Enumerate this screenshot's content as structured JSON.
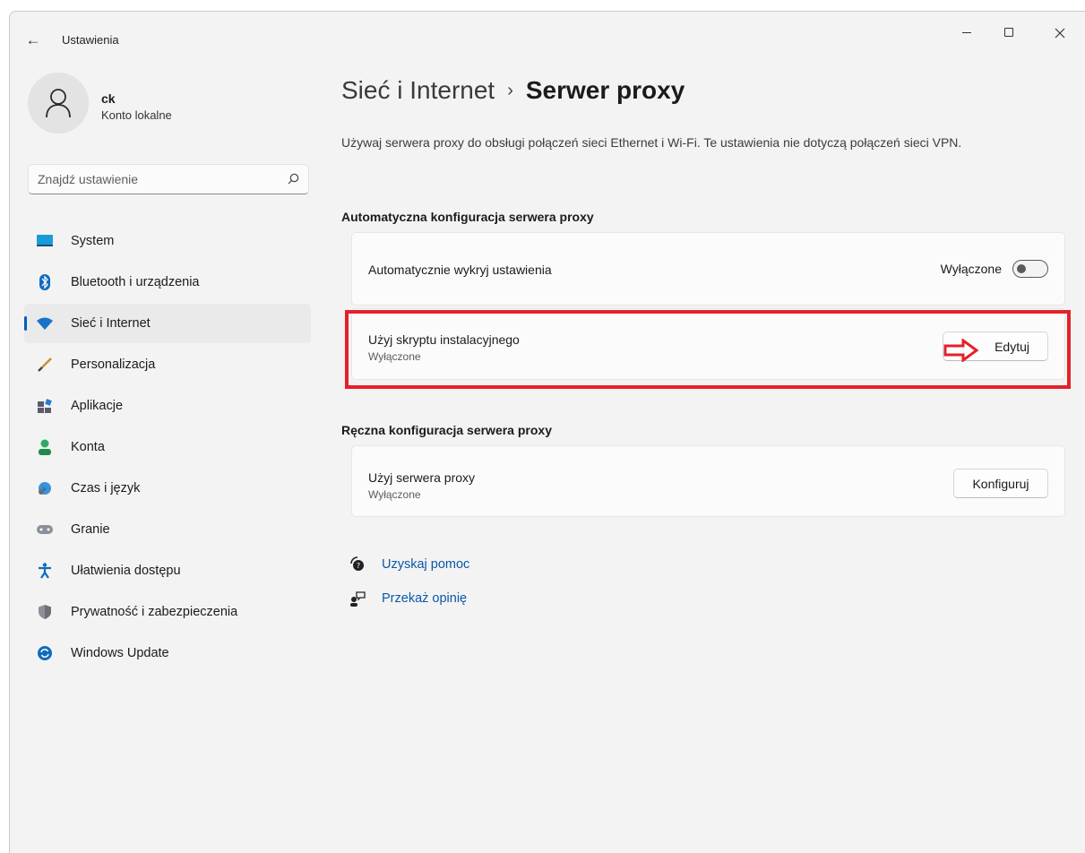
{
  "window": {
    "title": "Ustawienia",
    "back_icon": "back-arrow-icon"
  },
  "profile": {
    "name": "ck",
    "account_type": "Konto lokalne"
  },
  "search": {
    "placeholder": "Znajdź ustawienie"
  },
  "nav": {
    "items": [
      {
        "label": "System",
        "icon": "system-monitor-icon"
      },
      {
        "label": "Bluetooth i urządzenia",
        "icon": "bluetooth-icon"
      },
      {
        "label": "Sieć i Internet",
        "icon": "wifi-icon",
        "active": true
      },
      {
        "label": "Personalizacja",
        "icon": "brush-icon"
      },
      {
        "label": "Aplikacje",
        "icon": "apps-icon"
      },
      {
        "label": "Konta",
        "icon": "account-icon"
      },
      {
        "label": "Czas i język",
        "icon": "globe-clock-icon"
      },
      {
        "label": "Granie",
        "icon": "gamepad-icon"
      },
      {
        "label": "Ułatwienia dostępu",
        "icon": "accessibility-icon"
      },
      {
        "label": "Prywatność i zabezpieczenia",
        "icon": "shield-icon"
      },
      {
        "label": "Windows Update",
        "icon": "update-icon"
      }
    ]
  },
  "main": {
    "breadcrumb_parent": "Sieć i Internet",
    "breadcrumb_separator": "›",
    "breadcrumb_current": "Serwer proxy",
    "description": "Używaj serwera proxy do obsługi połączeń sieci Ethernet i Wi-Fi. Te ustawienia nie dotyczą połączeń sieci VPN.",
    "auto_section": {
      "title": "Automatyczna konfiguracja serwera proxy",
      "detect": {
        "label": "Automatycznie wykryj ustawienia",
        "state_label": "Wyłączone",
        "on": false
      },
      "script": {
        "label": "Użyj skryptu instalacyjnego",
        "sub": "Wyłączone",
        "button": "Edytuj"
      }
    },
    "manual_section": {
      "title": "Ręczna konfiguracja serwera proxy",
      "proxy": {
        "label": "Użyj serwera proxy",
        "sub": "Wyłączone",
        "button": "Konfiguruj"
      }
    },
    "links": {
      "help": "Uzyskaj pomoc",
      "feedback": "Przekaż opinię"
    }
  },
  "colors": {
    "accent": "#005fb8",
    "highlight": "#e3212b",
    "link": "#0a58a8"
  }
}
